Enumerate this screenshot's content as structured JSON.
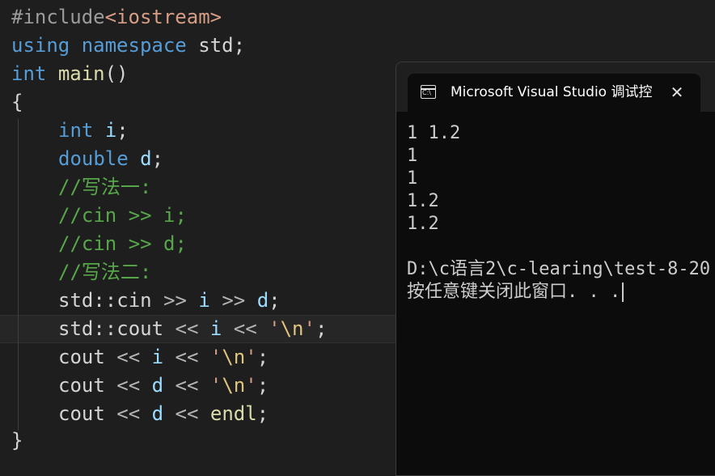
{
  "editor": {
    "lines": {
      "l1": {
        "pp": "#include",
        "inc": "<iostream>"
      },
      "l2": {
        "kw1": "using",
        "kw2": "namespace",
        "ns": "std",
        "semi": ";"
      },
      "l3": {
        "kw": "int",
        "fn": "main",
        "paren": "()"
      },
      "l4": {
        "brace": "{"
      },
      "l5": {
        "kw": "int",
        "var": "i",
        "semi": ";"
      },
      "l6": {
        "kw": "double",
        "var": "d",
        "semi": ";"
      },
      "l7": {
        "comment": "//写法一:"
      },
      "l8": {
        "comment": "//cin >> i;"
      },
      "l9": {
        "comment": "//cin >> d;"
      },
      "l10": {
        "comment": "//写法二:"
      },
      "l11": {
        "ns": "std::",
        "fn": "cin",
        "op1": ">>",
        "var1": "i",
        "op2": ">>",
        "var2": "d",
        "semi": ";"
      },
      "l12": {
        "ns": "std::",
        "fn": "cout",
        "op1": "<<",
        "var1": "i",
        "op2": "<<",
        "q1": "'",
        "esc": "\\n",
        "q2": "'",
        "semi": ";"
      },
      "l13": {
        "fn": "cout",
        "op1": "<<",
        "var1": "i",
        "op2": "<<",
        "q1": "'",
        "esc": "\\n",
        "q2": "'",
        "semi": ";"
      },
      "l14": {
        "fn": "cout",
        "op1": "<<",
        "var1": "d",
        "op2": "<<",
        "q1": "'",
        "esc": "\\n",
        "q2": "'",
        "semi": ";"
      },
      "l15": {
        "fn": "cout",
        "op1": "<<",
        "var1": "d",
        "op2": "<<",
        "endl": "endl",
        "semi": ";"
      },
      "l16": {
        "brace": "}"
      }
    }
  },
  "terminal": {
    "title": "Microsoft Visual Studio 调试控制台",
    "icon_text": "C:\\",
    "icon": "console-icon",
    "close": "✕",
    "output": [
      "1 1.2",
      "1",
      "1",
      "1.2",
      "1.2",
      "",
      "D:\\c语言2\\c-learing\\test-8-20",
      "按任意键关闭此窗口. . ."
    ]
  },
  "colors": {
    "background": "#1e1e1e",
    "keyword": "#569cd6",
    "function": "#dcdcaa",
    "variable": "#9cdcfe",
    "comment": "#57a64a",
    "string": "#d69d85",
    "terminal_bg": "#0c0c0c"
  }
}
